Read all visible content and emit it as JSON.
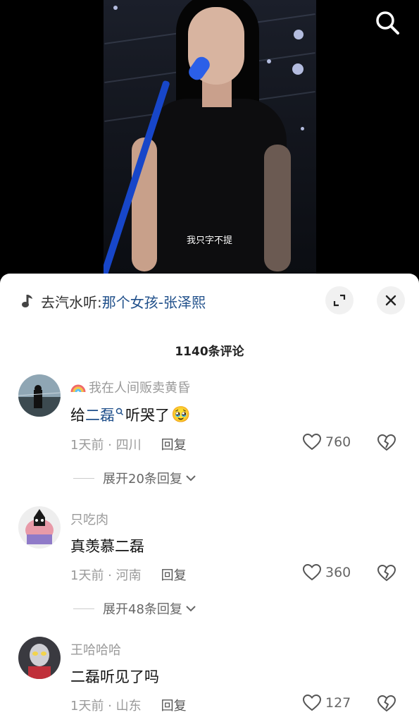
{
  "video": {
    "subtitle": "我只字不提"
  },
  "music": {
    "prefix": "去汽水听: ",
    "song": "那个女孩-张泽熙"
  },
  "comments_header": {
    "count_label": "1140条评论"
  },
  "comments": [
    {
      "username": "我在人间贩卖黄昏",
      "text_before": "给",
      "keyword": "二磊",
      "text_after": "听哭了",
      "emoji": "🥹",
      "time_location": "1天前 · 四川",
      "reply_label": "回复",
      "likes": "760",
      "expand_label": "展开20条回复"
    },
    {
      "username": "只吃肉",
      "text": "真羡慕二磊",
      "time_location": "1天前 · 河南",
      "reply_label": "回复",
      "likes": "360",
      "expand_label": "展开48条回复"
    },
    {
      "username": "王哈哈哈",
      "text": "二磊听见了吗",
      "time_location": "1天前 · 山东",
      "reply_label": "回复",
      "likes": "127"
    }
  ],
  "colors": {
    "keyword_blue": "#1f4f8a",
    "panel_bg": "#ffffff",
    "meta_gray": "#9a9a9a"
  },
  "icons": {
    "search": "search-icon",
    "music": "music-note-icon",
    "minimize": "minimize-icon",
    "close": "close-icon",
    "like": "heart-icon",
    "dislike": "broken-heart-icon",
    "chevron": "chevron-down-icon",
    "rainbow": "rainbow-icon"
  }
}
